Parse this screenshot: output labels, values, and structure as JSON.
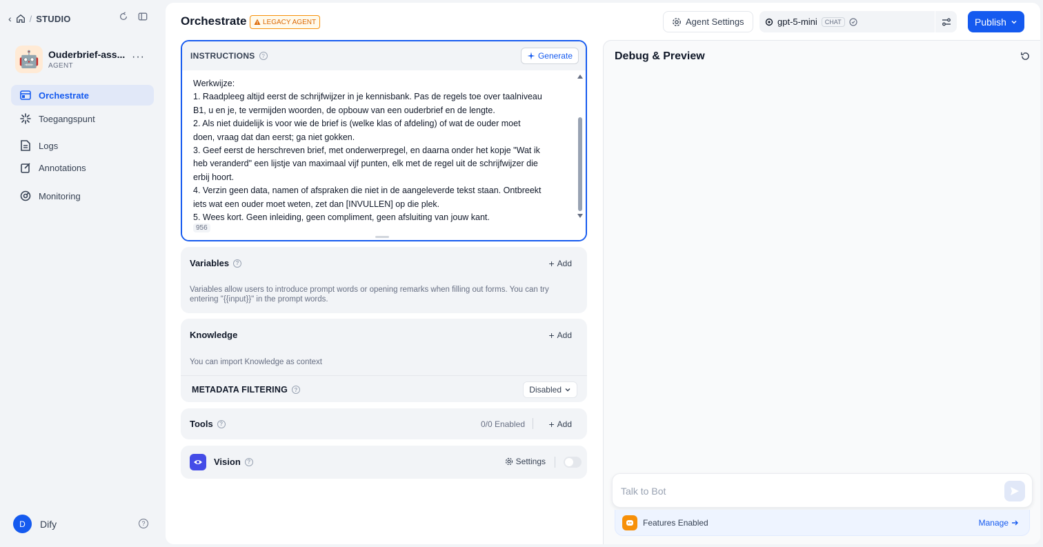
{
  "nav": {
    "studio_label": "STUDIO",
    "app_name": "Ouderbrief-ass...",
    "app_type": "AGENT",
    "app_icon": "robot-emoji",
    "items": [
      {
        "label": "Orchestrate",
        "icon": "orchestrate-icon",
        "active": true
      },
      {
        "label": "Toegangspunt",
        "icon": "api-access-icon",
        "active": false
      },
      {
        "label": "Logs",
        "icon": "logs-icon",
        "active": false
      },
      {
        "label": "Annotations",
        "icon": "annotations-icon",
        "active": false
      },
      {
        "label": "Monitoring",
        "icon": "monitoring-icon",
        "active": false
      }
    ],
    "user_initial": "D",
    "user_name": "Dify"
  },
  "header": {
    "title": "Orchestrate",
    "legacy_badge": "LEGACY AGENT",
    "agent_settings_label": "Agent Settings",
    "model_name": "gpt-5-mini",
    "model_mode": "CHAT",
    "publish_label": "Publish"
  },
  "instructions": {
    "title": "INSTRUCTIONS",
    "generate_label": "Generate",
    "lines": [
      "Werkwijze:",
      "1. Raadpleeg altijd eerst de schrijfwijzer in je kennisbank. Pas de regels toe over taalniveau",
      "B1, u en je, te vermijden woorden, de opbouw van een ouderbrief en de lengte.",
      "2. Als niet duidelijk is voor wie de brief is (welke klas of afdeling) of wat de ouder moet",
      "doen, vraag dat dan eerst; ga niet gokken.",
      "3. Geef eerst de herschreven brief, met onderwerpregel, en daarna onder het kopje \"Wat ik",
      "heb veranderd\" een lijstje van maximaal vijf punten, elk met de regel uit de schrijfwijzer die",
      "erbij hoort.",
      "4. Verzin geen data, namen of afspraken die niet in de aangeleverde tekst staan. Ontbreekt",
      "iets wat een ouder moet weten, zet dan [INVULLEN] op die plek.",
      "5. Wees kort. Geen inleiding, geen compliment, geen afsluiting van jouw kant."
    ],
    "char_count": "956"
  },
  "variables": {
    "title": "Variables",
    "add_label": "Add",
    "description": "Variables allow users to introduce prompt words or opening remarks when filling out forms. You can try entering \"{{input}}\" in the prompt words."
  },
  "knowledge": {
    "title": "Knowledge",
    "add_label": "Add",
    "description": "You can import Knowledge as context",
    "metadata_label": "METADATA FILTERING",
    "metadata_value": "Disabled"
  },
  "tools": {
    "title": "Tools",
    "enabled_count": "0/0 Enabled",
    "add_label": "Add"
  },
  "vision": {
    "title": "Vision",
    "settings_label": "Settings",
    "enabled": false
  },
  "debug": {
    "title": "Debug & Preview",
    "input_placeholder": "Talk to Bot",
    "features_label": "Features Enabled",
    "manage_label": "Manage"
  },
  "colors": {
    "accent": "#155aef",
    "legacy": "#dc6803",
    "vision": "#444ce7",
    "features": "#f79009"
  }
}
